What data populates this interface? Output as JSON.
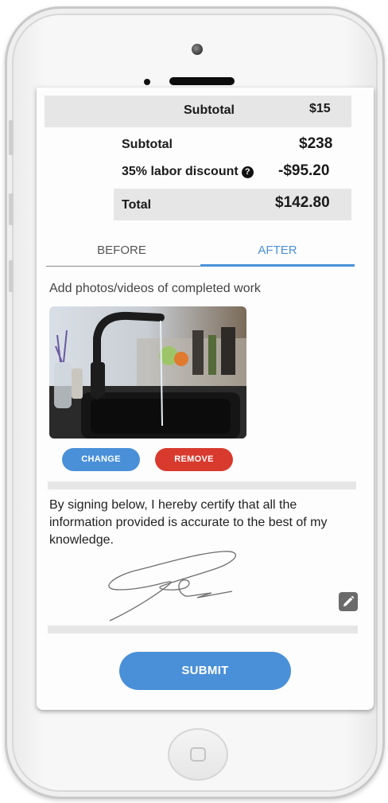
{
  "summary": {
    "top_row": {
      "label": "Subtotal",
      "value": "$15"
    },
    "subtotal": {
      "label": "Subtotal",
      "value": "$238"
    },
    "discount": {
      "label": "35% labor discount",
      "help_icon": "question-circle-icon",
      "value": "-$95.20"
    },
    "total": {
      "label": "Total",
      "value": "$142.80"
    }
  },
  "tabs": [
    {
      "label": "BEFORE",
      "active": false
    },
    {
      "label": "AFTER",
      "active": true
    }
  ],
  "photos": {
    "hint": "Add photos/videos of completed work",
    "image_alt": "kitchen sink with running faucet",
    "change_label": "CHANGE",
    "remove_label": "REMOVE"
  },
  "certification": {
    "text": "By signing below, I hereby certify that all the information provided is accurate to the best of my knowledge.",
    "edit_icon": "pencil-icon"
  },
  "submit_label": "SUBMIT",
  "colors": {
    "accent": "#4a90d9",
    "danger": "#d83a2e",
    "row_grey": "#e6e6e6"
  }
}
